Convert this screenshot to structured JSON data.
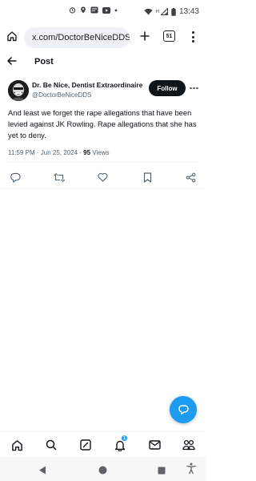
{
  "status_bar": {
    "time": "13:43",
    "network": "H",
    "icons": [
      "alarm-icon",
      "location-icon",
      "message-icon",
      "youtube-icon",
      "dot-icon",
      "wifi-icon",
      "signal-icon",
      "battery-icon"
    ]
  },
  "browser": {
    "url": "x.com/DoctorBeNiceDDS",
    "tab_count": "51"
  },
  "header": {
    "title": "Post"
  },
  "post": {
    "author_name": "Dr. Be Nice, Dentist Extraordinaire",
    "author_handle": "@DoctorBeNiceDDS",
    "follow_label": "Follow",
    "text": "And least we forget the rape allegations that have been levied against JK Rowling.  Rape allegations that she has yet to deny.",
    "timestamp": "11:59 PM · Jun 25, 2024 · ",
    "views_count": "95",
    "views_label": " Views"
  },
  "bottom_nav": {
    "notification_badge": "1",
    "items": [
      "home-icon",
      "search-icon",
      "grok-icon",
      "notifications-icon",
      "messages-icon",
      "communities-icon"
    ]
  },
  "colors": {
    "accent": "#1d9bf0",
    "text": "#0f1419",
    "muted": "#536471"
  }
}
